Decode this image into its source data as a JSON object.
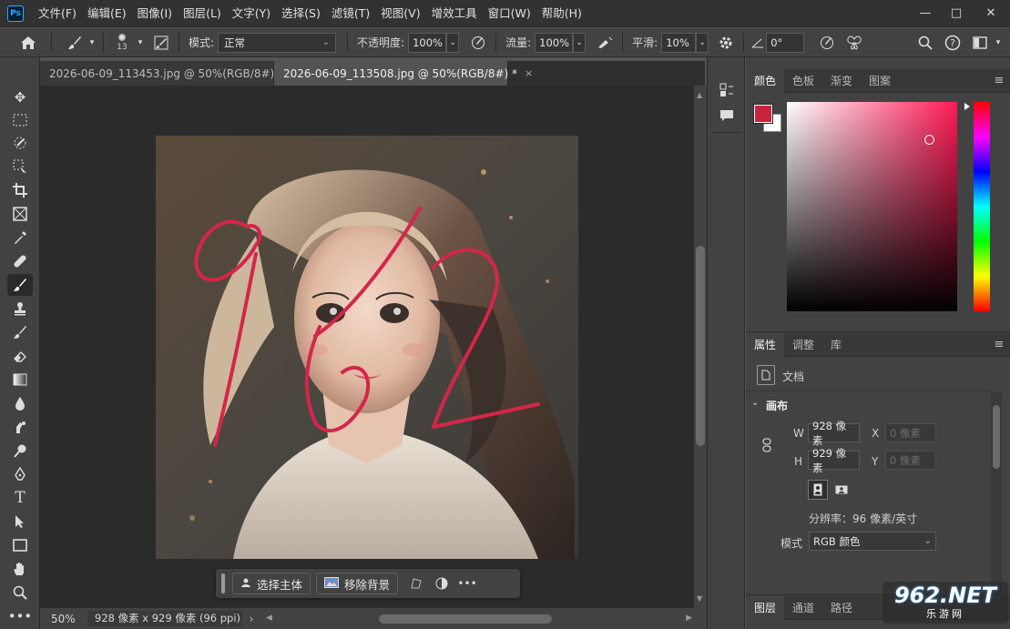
{
  "app": {
    "logo": "Ps"
  },
  "menu": [
    "文件(F)",
    "编辑(E)",
    "图像(I)",
    "图层(L)",
    "文字(Y)",
    "选择(S)",
    "滤镜(T)",
    "视图(V)",
    "增效工具",
    "窗口(W)",
    "帮助(H)"
  ],
  "window_controls": {
    "minimize": "—",
    "maximize": "□",
    "close": "✕"
  },
  "options": {
    "brush_size": "13",
    "mode_label": "模式:",
    "mode_value": "正常",
    "opacity_label": "不透明度:",
    "opacity_value": "100%",
    "flow_label": "流量:",
    "flow_value": "100%",
    "smooth_label": "平滑:",
    "smooth_value": "10%",
    "angle_value": "0°"
  },
  "tabs": [
    {
      "label": "2026-06-09_113453.jpg @ 50%(RGB/8#) *",
      "close": "×"
    },
    {
      "label": "2026-06-09_113508.jpg @ 50%(RGB/8#) *",
      "close": "×"
    }
  ],
  "canvas": {
    "overlay_text": "962"
  },
  "context_bar": {
    "select_subject": "选择主体",
    "remove_background": "移除背景",
    "more": "•••"
  },
  "status": {
    "zoom": "50%",
    "info": "928 像素 x 929 像素 (96 ppi)",
    "arrow": "›"
  },
  "color_panel": {
    "tabs": [
      "颜色",
      "色板",
      "渐变",
      "图案"
    ],
    "foreground": "#c8243f",
    "background": "#ffffff",
    "hue_color": "#ff1a55"
  },
  "properties_panel": {
    "tabs": [
      "属性",
      "调整",
      "库"
    ],
    "doc_label": "文档",
    "section_title": "画布",
    "w_label": "W",
    "w_value": "928 像素",
    "h_label": "H",
    "h_value": "929 像素",
    "x_label": "X",
    "x_placeholder": "0 像素",
    "y_label": "Y",
    "y_placeholder": "0 像素",
    "resolution": "分辨率：96 像素/英寸",
    "mode_label": "模式",
    "mode_value": "RGB 颜色"
  },
  "layers_panel": {
    "tabs": [
      "图层",
      "通道",
      "路径"
    ]
  },
  "watermark": {
    "text": "962.NET",
    "sub": "乐游网"
  }
}
